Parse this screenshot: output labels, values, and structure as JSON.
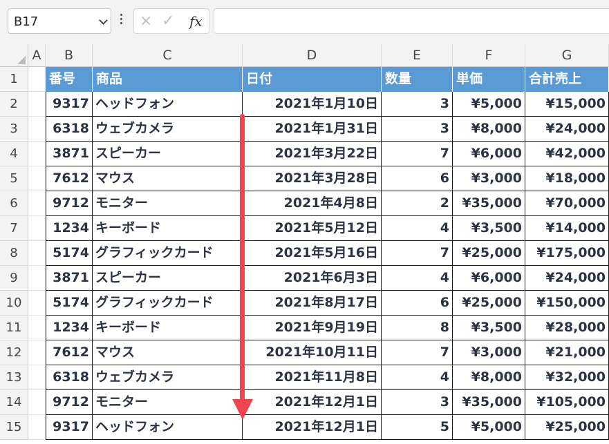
{
  "formula_bar": {
    "name_box": "B17",
    "cancel_icon": "×",
    "enter_icon": "✓",
    "fx_label": "fx",
    "formula": ""
  },
  "columns": [
    "A",
    "B",
    "C",
    "D",
    "E",
    "F",
    "G"
  ],
  "rows": [
    "1",
    "2",
    "3",
    "4",
    "5",
    "6",
    "7",
    "8",
    "9",
    "10",
    "11",
    "12",
    "13",
    "14",
    "15"
  ],
  "table": {
    "headers": [
      "番号",
      "商品",
      "日付",
      "数量",
      "単価",
      "合計売上"
    ],
    "rows": [
      [
        "9317",
        "ヘッドフォン",
        "2021年1月10日",
        "3",
        "¥5,000",
        "¥15,000"
      ],
      [
        "6318",
        "ウェブカメラ",
        "2021年1月31日",
        "3",
        "¥8,000",
        "¥24,000"
      ],
      [
        "3871",
        "スピーカー",
        "2021年3月22日",
        "7",
        "¥6,000",
        "¥42,000"
      ],
      [
        "7612",
        "マウス",
        "2021年3月28日",
        "6",
        "¥3,000",
        "¥18,000"
      ],
      [
        "9712",
        "モニター",
        "2021年4月8日",
        "2",
        "¥35,000",
        "¥70,000"
      ],
      [
        "1234",
        "キーボード",
        "2021年5月12日",
        "4",
        "¥3,500",
        "¥14,000"
      ],
      [
        "5174",
        "グラフィックカード",
        "2021年5月16日",
        "7",
        "¥25,000",
        "¥175,000"
      ],
      [
        "3871",
        "スピーカー",
        "2021年6月3日",
        "4",
        "¥6,000",
        "¥24,000"
      ],
      [
        "5174",
        "グラフィックカード",
        "2021年8月17日",
        "6",
        "¥25,000",
        "¥150,000"
      ],
      [
        "1234",
        "キーボード",
        "2021年9月19日",
        "8",
        "¥3,500",
        "¥28,000"
      ],
      [
        "7612",
        "マウス",
        "2021年10月11日",
        "7",
        "¥3,000",
        "¥21,000"
      ],
      [
        "6318",
        "ウェブカメラ",
        "2021年11月8日",
        "4",
        "¥8,000",
        "¥32,000"
      ],
      [
        "9712",
        "モニター",
        "2021年12月1日",
        "3",
        "¥35,000",
        "¥105,000"
      ],
      [
        "9317",
        "ヘッドフォン",
        "2021年12月1日",
        "5",
        "¥5,000",
        "¥25,000"
      ]
    ]
  },
  "colors": {
    "header_fill": "#5b9bd5",
    "arrow": "#f0444f"
  },
  "annotation": {
    "icon": "down-arrow-icon"
  }
}
